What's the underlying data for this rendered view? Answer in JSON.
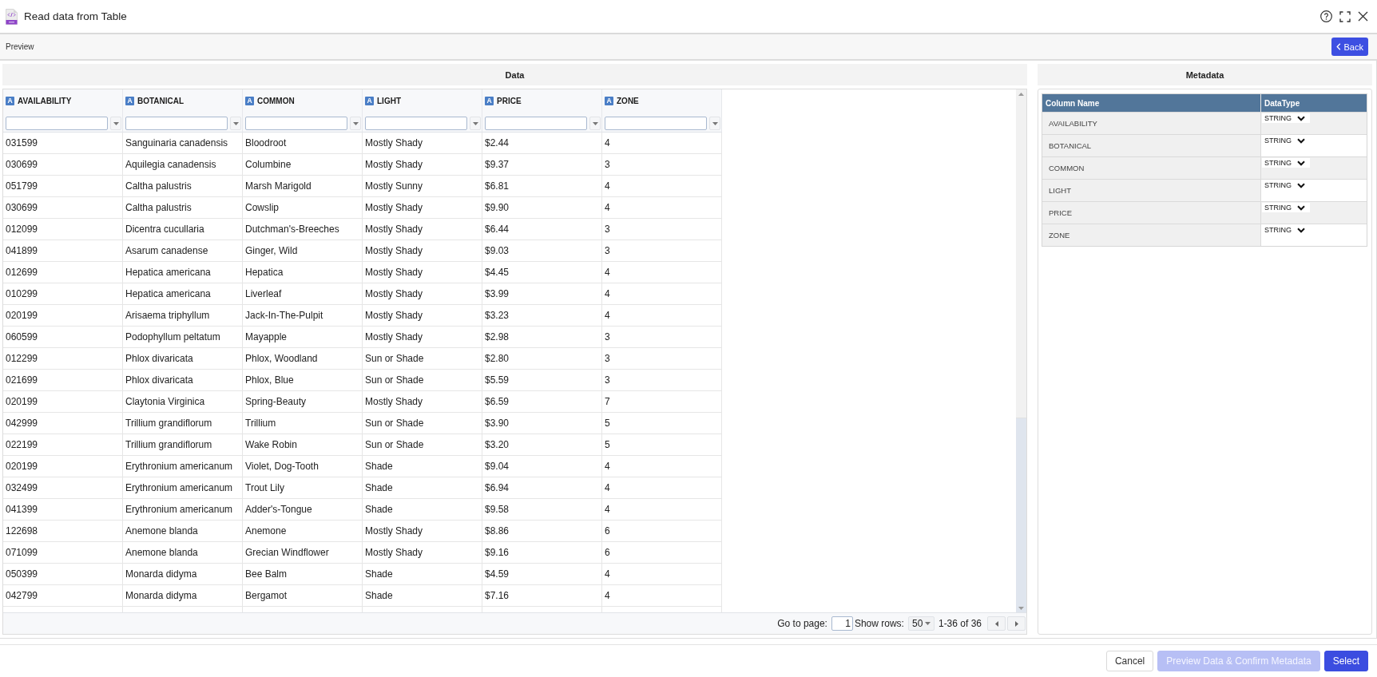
{
  "window": {
    "title": "Read data from Table"
  },
  "toolbar": {
    "label": "Preview",
    "back_button": "Back"
  },
  "data_panel": {
    "title": "Data",
    "columns": [
      {
        "name": "AVAILABILITY",
        "type_badge": "A"
      },
      {
        "name": "BOTANICAL",
        "type_badge": "A"
      },
      {
        "name": "COMMON",
        "type_badge": "A"
      },
      {
        "name": "LIGHT",
        "type_badge": "A"
      },
      {
        "name": "PRICE",
        "type_badge": "A"
      },
      {
        "name": "ZONE",
        "type_badge": "A"
      }
    ],
    "rows": [
      [
        "031599",
        "Sanguinaria canadensis",
        "Bloodroot",
        "Mostly Shady",
        "$2.44",
        "4"
      ],
      [
        "030699",
        "Aquilegia canadensis",
        "Columbine",
        "Mostly Shady",
        "$9.37",
        "3"
      ],
      [
        "051799",
        "Caltha palustris",
        "Marsh Marigold",
        "Mostly Sunny",
        "$6.81",
        "4"
      ],
      [
        "030699",
        "Caltha palustris",
        "Cowslip",
        "Mostly Shady",
        "$9.90",
        "4"
      ],
      [
        "012099",
        "Dicentra cucullaria",
        "Dutchman's-Breeches",
        "Mostly Shady",
        "$6.44",
        "3"
      ],
      [
        "041899",
        "Asarum canadense",
        "Ginger, Wild",
        "Mostly Shady",
        "$9.03",
        "3"
      ],
      [
        "012699",
        "Hepatica americana",
        "Hepatica",
        "Mostly Shady",
        "$4.45",
        "4"
      ],
      [
        "010299",
        "Hepatica americana",
        "Liverleaf",
        "Mostly Shady",
        "$3.99",
        "4"
      ],
      [
        "020199",
        "Arisaema triphyllum",
        "Jack-In-The-Pulpit",
        "Mostly Shady",
        "$3.23",
        "4"
      ],
      [
        "060599",
        "Podophyllum peltatum",
        "Mayapple",
        "Mostly Shady",
        "$2.98",
        "3"
      ],
      [
        "012299",
        "Phlox divaricata",
        "Phlox, Woodland",
        "Sun or Shade",
        "$2.80",
        "3"
      ],
      [
        "021699",
        "Phlox divaricata",
        "Phlox, Blue",
        "Sun or Shade",
        "$5.59",
        "3"
      ],
      [
        "020199",
        "Claytonia Virginica",
        "Spring-Beauty",
        "Mostly Shady",
        "$6.59",
        "7"
      ],
      [
        "042999",
        "Trillium grandiflorum",
        "Trillium",
        "Sun or Shade",
        "$3.90",
        "5"
      ],
      [
        "022199",
        "Trillium grandiflorum",
        "Wake Robin",
        "Sun or Shade",
        "$3.20",
        "5"
      ],
      [
        "020199",
        "Erythronium americanum",
        "Violet, Dog-Tooth",
        "Shade",
        "$9.04",
        "4"
      ],
      [
        "032499",
        "Erythronium americanum",
        "Trout Lily",
        "Shade",
        "$6.94",
        "4"
      ],
      [
        "041399",
        "Erythronium americanum",
        "Adder's-Tongue",
        "Shade",
        "$9.58",
        "4"
      ],
      [
        "122698",
        "Anemone blanda",
        "Anemone",
        "Mostly Shady",
        "$8.86",
        "6"
      ],
      [
        "071099",
        "Anemone blanda",
        "Grecian Windflower",
        "Mostly Shady",
        "$9.16",
        "6"
      ],
      [
        "050399",
        "Monarda didyma",
        "Bee Balm",
        "Shade",
        "$4.59",
        "4"
      ],
      [
        "042799",
        "Monarda didyma",
        "Bergamot",
        "Shade",
        "$7.16",
        "4"
      ]
    ],
    "pagination": {
      "go_to_page_label": "Go to page:",
      "page": "1",
      "show_rows_label": "Show rows:",
      "rows_per_page": "50",
      "range": "1-36 of 36"
    }
  },
  "metadata_panel": {
    "title": "Metadata",
    "columns": [
      "Column Name",
      "DataType"
    ],
    "rows": [
      {
        "column_name": "AVAILABILITY",
        "data_type": "STRING"
      },
      {
        "column_name": "BOTANICAL",
        "data_type": "STRING"
      },
      {
        "column_name": "COMMON",
        "data_type": "STRING"
      },
      {
        "column_name": "LIGHT",
        "data_type": "STRING"
      },
      {
        "column_name": "PRICE",
        "data_type": "STRING"
      },
      {
        "column_name": "ZONE",
        "data_type": "STRING"
      }
    ]
  },
  "footer_buttons": [
    {
      "label": "Cancel",
      "kind": "outline",
      "disabled": false
    },
    {
      "label": "Preview Data & Confirm Metadata",
      "kind": "primary",
      "disabled": true
    },
    {
      "label": "Select",
      "kind": "primary",
      "disabled": false
    }
  ]
}
